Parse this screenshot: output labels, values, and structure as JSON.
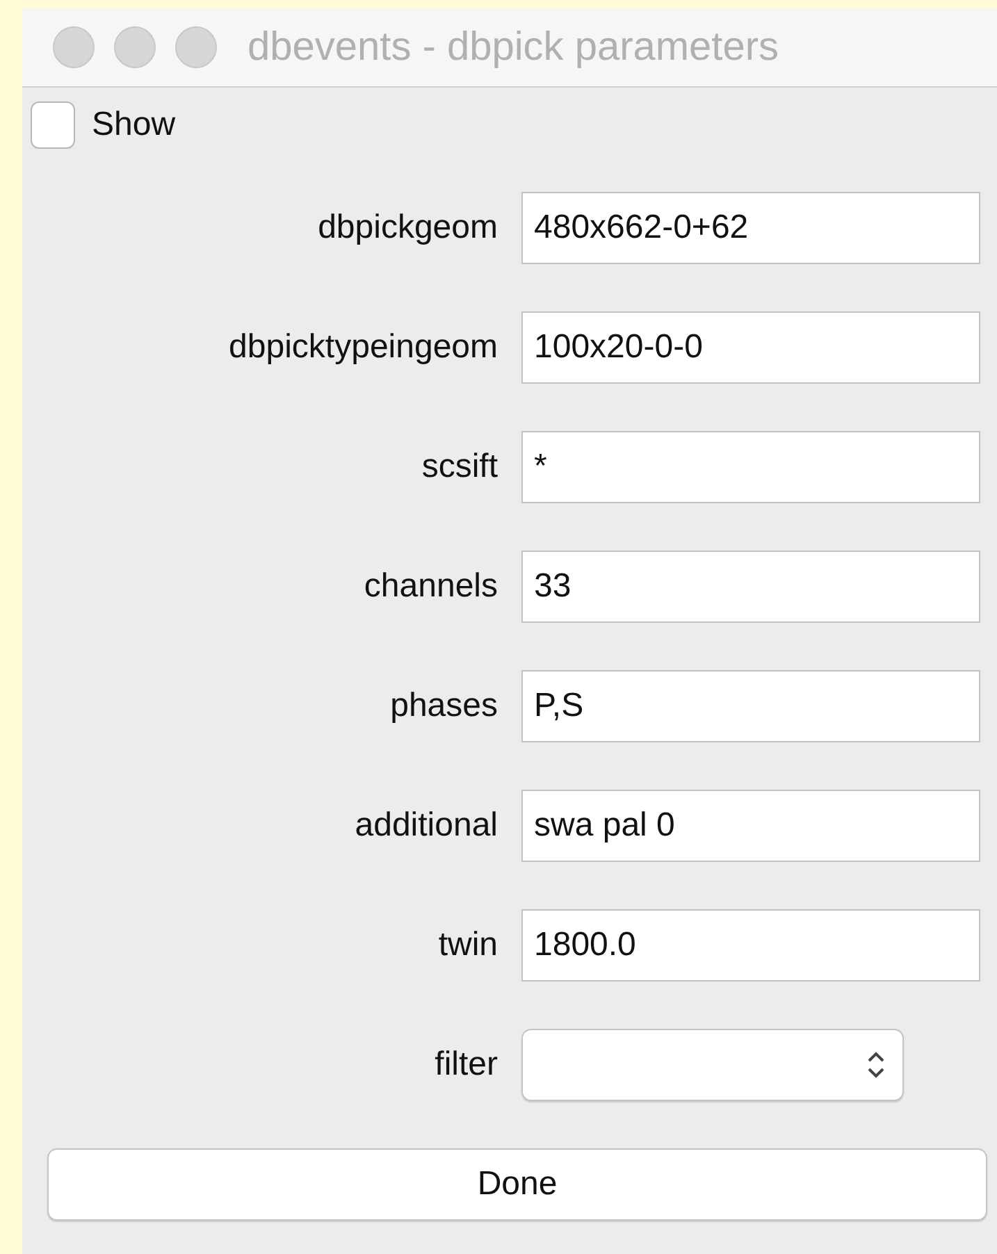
{
  "window": {
    "title": "dbevents - dbpick parameters",
    "active": false
  },
  "show": {
    "label": "Show",
    "checked": false
  },
  "parameters": [
    {
      "label": "dbpickgeom",
      "kind": "text",
      "value": "480x662-0+62"
    },
    {
      "label": "dbpicktypeingeom",
      "kind": "text",
      "value": "100x20-0-0"
    },
    {
      "label": "scsift",
      "kind": "text",
      "value": "*"
    },
    {
      "label": "channels",
      "kind": "text",
      "value": "33"
    },
    {
      "label": "phases",
      "kind": "text",
      "value": "P,S"
    },
    {
      "label": "additional",
      "kind": "text",
      "value": "swa pal 0"
    },
    {
      "label": "twin",
      "kind": "text",
      "value": "1800.0"
    },
    {
      "label": "filter",
      "kind": "select"
    }
  ],
  "buttons": [
    "Done"
  ]
}
